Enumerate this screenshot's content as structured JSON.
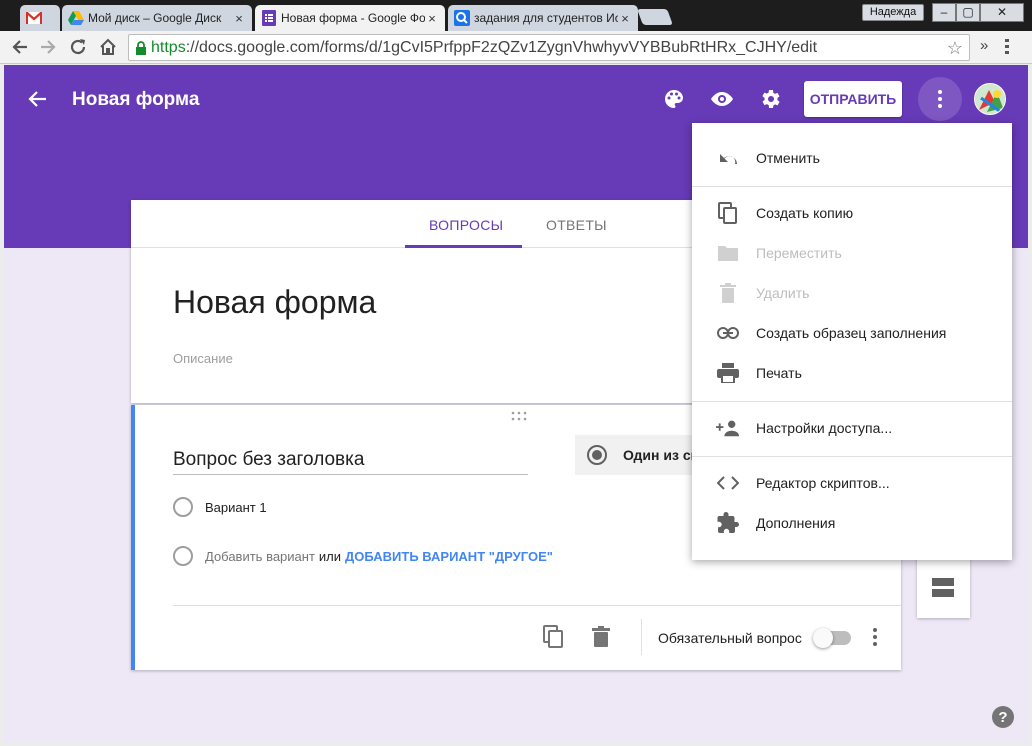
{
  "browser": {
    "tabs": [
      {
        "title": "",
        "icon": "gmail-icon"
      },
      {
        "title": "Мой диск – Google Диск",
        "icon": "drive-icon"
      },
      {
        "title": "Новая форма - Google Форм",
        "icon": "forms-icon",
        "active": true
      },
      {
        "title": "задания для студентов Ис",
        "icon": "search-icon"
      }
    ],
    "user": "Надежда",
    "url_https": "https",
    "url_rest": "://docs.google.com/forms/d/1gCvI5PrfppF2zQZv1ZygnVhwhyvVYBBubRtHRx_CJHY/edit",
    "close_glyph": "×",
    "minimize_glyph": "–",
    "restore_glyph": "▢",
    "window_close_glyph": "✕",
    "more_glyph": "»"
  },
  "header": {
    "title": "Новая форма",
    "send_label": "ОТПРАВИТЬ",
    "accent": "#673ab7"
  },
  "form": {
    "tabs": [
      {
        "label": "ВОПРОСЫ",
        "active": true
      },
      {
        "label": "ОТВЕТЫ",
        "active": false
      }
    ],
    "title": "Новая форма",
    "description_placeholder": "Описание"
  },
  "question": {
    "title": "Вопрос без заголовка",
    "type_label": "Один из сп",
    "option_1": "Вариант 1",
    "add_option": "Добавить вариант",
    "or": "или",
    "add_other": "ДОБАВИТЬ ВАРИАНТ \"ДРУГОЕ\"",
    "required_label": "Обязательный вопрос",
    "required": false
  },
  "menu": {
    "items": [
      {
        "label": "Отменить",
        "icon": "undo-icon",
        "enabled": true
      },
      {
        "label": "Создать копию",
        "icon": "copy-icon",
        "enabled": true
      },
      {
        "label": "Переместить",
        "icon": "folder-icon",
        "enabled": false
      },
      {
        "label": "Удалить",
        "icon": "trash-icon",
        "enabled": false
      },
      {
        "label": "Создать образец заполнения",
        "icon": "link-icon",
        "enabled": true
      },
      {
        "label": "Печать",
        "icon": "print-icon",
        "enabled": true
      },
      {
        "label": "Настройки доступа...",
        "icon": "add-people-icon",
        "enabled": true
      },
      {
        "label": "Редактор скриптов...",
        "icon": "code-icon",
        "enabled": true
      },
      {
        "label": "Дополнения",
        "icon": "puzzle-icon",
        "enabled": true
      }
    ]
  },
  "help_label": "?"
}
